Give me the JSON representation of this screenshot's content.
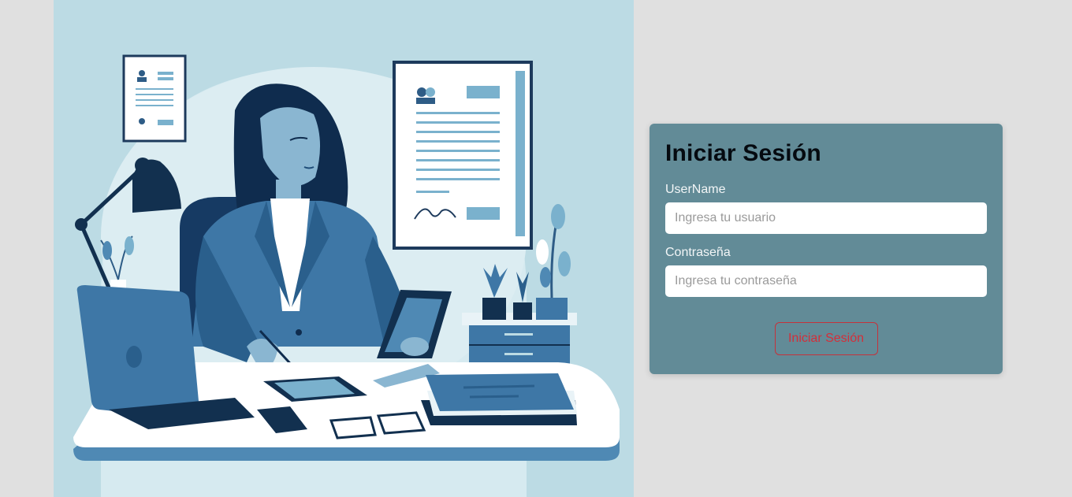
{
  "illustration": {
    "description_icon": "woman-at-desk-illustration",
    "background_color": "#bcdbe4"
  },
  "login": {
    "title": "Iniciar Sesión",
    "username_label": "UserName",
    "username_placeholder": "Ingresa tu usuario",
    "username_value": "",
    "password_label": "Contraseña",
    "password_placeholder": "Ingresa tu contraseña",
    "password_value": "",
    "submit_label": "Iniciar Sesión"
  },
  "colors": {
    "card": "#628b97",
    "page_background": "#e0e0e0",
    "button_accent": "#d32f3a"
  }
}
